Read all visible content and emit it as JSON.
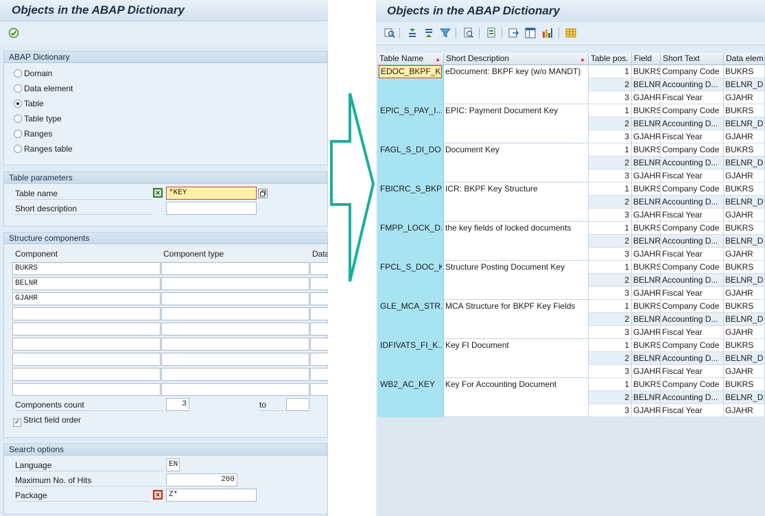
{
  "left": {
    "title": "Objects in the ABAP Dictionary",
    "dictionary": {
      "header": "ABAP Dictionary",
      "options": [
        "Domain",
        "Data element",
        "Table",
        "Table type",
        "Ranges",
        "Ranges table"
      ],
      "selected": "Table"
    },
    "table_params": {
      "header": "Table parameters",
      "table_name_label": "Table name",
      "table_name_value": "*KEY",
      "short_desc_label": "Short description",
      "short_desc_value": ""
    },
    "structure": {
      "header": "Structure components",
      "col_component": "Component",
      "col_type": "Component type",
      "col_data": "Data",
      "rows": [
        "BUKRS",
        "BELNR",
        "GJAHR",
        "",
        "",
        "",
        "",
        "",
        ""
      ],
      "count_label": "Components count",
      "count_value": "3",
      "to_label": "to",
      "to_value": "",
      "strict_label": "Strict field order",
      "strict_checked": true
    },
    "search": {
      "header": "Search options",
      "language_label": "Language",
      "language_value": "EN",
      "max_hits_label": "Maximum No. of Hits",
      "max_hits_value": "200",
      "package_label": "Package",
      "package_value": "Z*"
    }
  },
  "right": {
    "title": "Objects in the ABAP Dictionary",
    "columns": [
      "Table Name",
      "Short Description",
      "Table pos.",
      "Field",
      "Short Text",
      "Data elem."
    ],
    "groups": [
      {
        "name": "EDOC_BKPF_K...",
        "desc": "eDocument: BKPF key (w/o MANDT)"
      },
      {
        "name": "EPIC_S_PAY_I...",
        "desc": "EPIC: Payment Document Key"
      },
      {
        "name": "FAGL_S_DI_DO...",
        "desc": "Document Key"
      },
      {
        "name": "FBICRC_S_BKP...",
        "desc": "ICR: BKPF Key Structure"
      },
      {
        "name": "FMPP_LOCK_D...",
        "desc": "the key fields of locked documents"
      },
      {
        "name": "FPCL_S_DOC_K...",
        "desc": "Structure Posting Document Key"
      },
      {
        "name": "GLE_MCA_STR...",
        "desc": "MCA Structure for BKPF Key Fields"
      },
      {
        "name": "IDFIVATS_FI_K...",
        "desc": "Key FI Document"
      },
      {
        "name": "WB2_AC_KEY",
        "desc": "Key For Accounting Document"
      }
    ],
    "fields": [
      {
        "pos": "1",
        "field": "BUKRS",
        "text": "Company Code",
        "elem": "BUKRS"
      },
      {
        "pos": "2",
        "field": "BELNR",
        "text": "Accounting D...",
        "elem": "BELNR_D"
      },
      {
        "pos": "3",
        "field": "GJAHR",
        "text": "Fiscal Year",
        "elem": "GJAHR"
      }
    ]
  },
  "colors": {
    "panel_bg": "#dfebf5",
    "key_col": "#a8e3f2",
    "arrow": "#19b09a",
    "focus": "#fff1a8"
  }
}
